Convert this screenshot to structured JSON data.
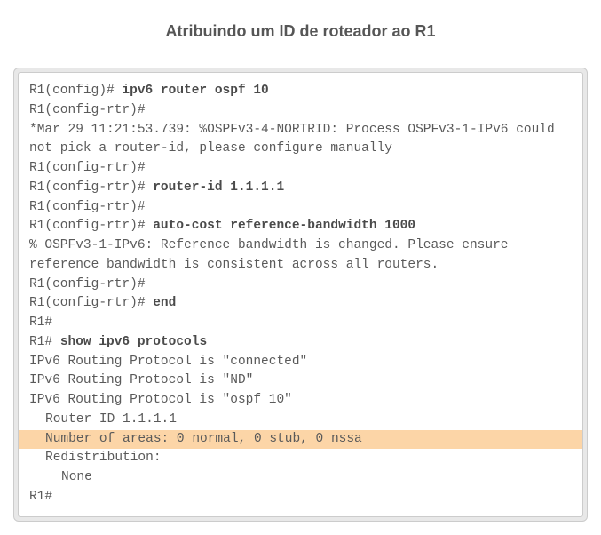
{
  "title": "Atribuindo um ID de roteador ao R1",
  "lines": {
    "l1_prompt": "R1(config)# ",
    "l1_cmd": "ipv6 router ospf 10",
    "l2": "R1(config-rtr)#",
    "l3": "*Mar 29 11:21:53.739: %OSPFv3-4-NORTRID: Process OSPFv3-1-IPv6 could not pick a router-id, please configure manually",
    "l4": "R1(config-rtr)#",
    "l5_prompt": "R1(config-rtr)# ",
    "l5_cmd": "router-id 1.1.1.1",
    "l6": "R1(config-rtr)#",
    "l7_prompt": "R1(config-rtr)# ",
    "l7_cmd": "auto-cost reference-bandwidth 1000",
    "l8": "% OSPFv3-1-IPv6: Reference bandwidth is changed. Please ensure reference bandwidth is consistent across all routers.",
    "l9": "R1(config-rtr)#",
    "l10_prompt": "R1(config-rtr)# ",
    "l10_cmd": "end",
    "l11": "R1#",
    "l12_prompt": "R1# ",
    "l12_cmd": "show ipv6 protocols",
    "l13": "IPv6 Routing Protocol is \"connected\"",
    "l14": "IPv6 Routing Protocol is \"ND\"",
    "l15": "IPv6 Routing Protocol is \"ospf 10\"",
    "l16": "Router ID 1.1.1.1",
    "l17": "Number of areas: 0 normal, 0 stub, 0 nssa",
    "l18": "Redistribution:",
    "l19": "None",
    "l20": "R1#"
  }
}
